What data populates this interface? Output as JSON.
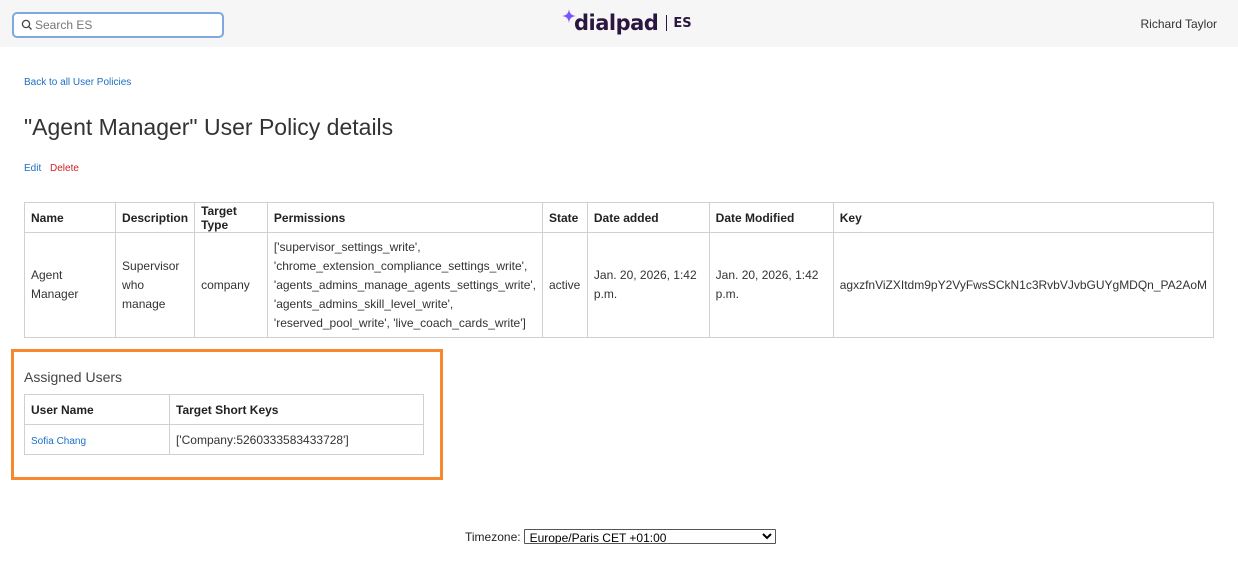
{
  "header": {
    "search_placeholder": "Search ES",
    "logo_text": "dialpad",
    "logo_suffix": "ES",
    "user_name": "Richard Taylor",
    "brand_color": "#2b1640",
    "accent_color": "#7c52ff"
  },
  "page": {
    "back_link": "Back to all User Policies",
    "title": "\"Agent Manager\" User Policy details",
    "edit_label": "Edit",
    "delete_label": "Delete"
  },
  "policy_table": {
    "headers": [
      "Name",
      "Description",
      "Target Type",
      "Permissions",
      "State",
      "Date added",
      "Date Modified",
      "Key"
    ],
    "row": {
      "name": "Agent Manager",
      "description_lines": [
        "Supervisor",
        "who",
        "manage"
      ],
      "target_type": "company",
      "permissions_lines": [
        "['supervisor_settings_write',",
        "'chrome_extension_compliance_settings_write',",
        "'agents_admins_manage_agents_settings_write',",
        "'agents_admins_skill_level_write',",
        "'reserved_pool_write', 'live_coach_cards_write']"
      ],
      "state": "active",
      "date_added": "Jan. 20, 2026, 1:42 p.m.",
      "date_modified": "Jan. 20, 2026, 1:42 p.m.",
      "key": "agxzfnViZXItdm9pY2VyFwsSCkN1c3RvbVJvbGUYgMDQn_PA2AoM"
    }
  },
  "assigned_users": {
    "title": "Assigned Users",
    "headers": [
      "User Name",
      "Target Short Keys"
    ],
    "rows": [
      {
        "user": "Sofia Chang",
        "keys": "['Company:5260333583433728']"
      }
    ],
    "highlight_color": "#f7882e"
  },
  "footer": {
    "timezone_label": "Timezone:",
    "timezone_value": "Europe/Paris CET +01:00"
  }
}
